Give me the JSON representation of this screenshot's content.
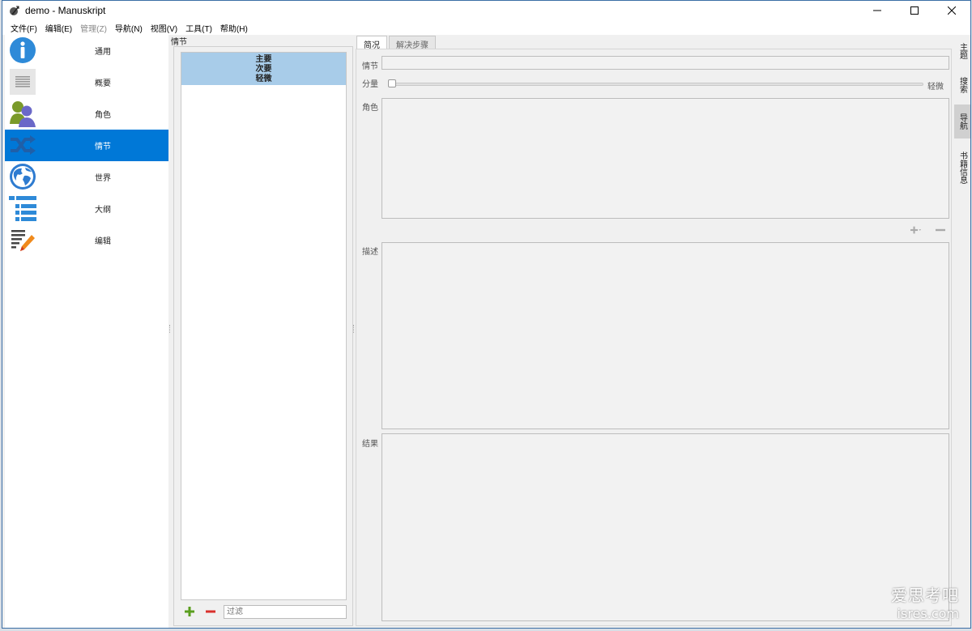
{
  "window": {
    "title": "demo - Manuskript"
  },
  "menu": [
    "文件(F)",
    "编辑(E)",
    "管理(Z)",
    "导航(N)",
    "视图(V)",
    "工具(T)",
    "帮助(H)"
  ],
  "sidebar": {
    "items": [
      {
        "label": "通用",
        "icon": "info-icon"
      },
      {
        "label": "概要",
        "icon": "summary-icon"
      },
      {
        "label": "角色",
        "icon": "characters-icon"
      },
      {
        "label": "情节",
        "icon": "plot-icon"
      },
      {
        "label": "世界",
        "icon": "globe-icon"
      },
      {
        "label": "大纲",
        "icon": "outline-icon"
      },
      {
        "label": "编辑",
        "icon": "editor-icon"
      }
    ],
    "active_index": 3
  },
  "plots": {
    "header": "情节",
    "list": [
      "主要",
      "次要",
      "轻微"
    ],
    "filter_placeholder": "过滤"
  },
  "detail": {
    "tabs": [
      "简况",
      "解决步骤"
    ],
    "plot_label": "情节",
    "importance_label": "分量",
    "importance_value_text": "轻微",
    "importance_level": 0,
    "characters_label": "角色",
    "description_label": "描述",
    "result_label": "结果"
  },
  "right_tabs": [
    "主题",
    "搜索",
    "导航",
    "书籍信息"
  ],
  "right_tabs_active": 2,
  "watermark": {
    "line1": "爱思考吧",
    "line2": "isres.com"
  },
  "colors": {
    "accent": "#0078d7",
    "selection": "#a8cce9",
    "add": "#5a9e1e",
    "remove": "#d9302c"
  }
}
